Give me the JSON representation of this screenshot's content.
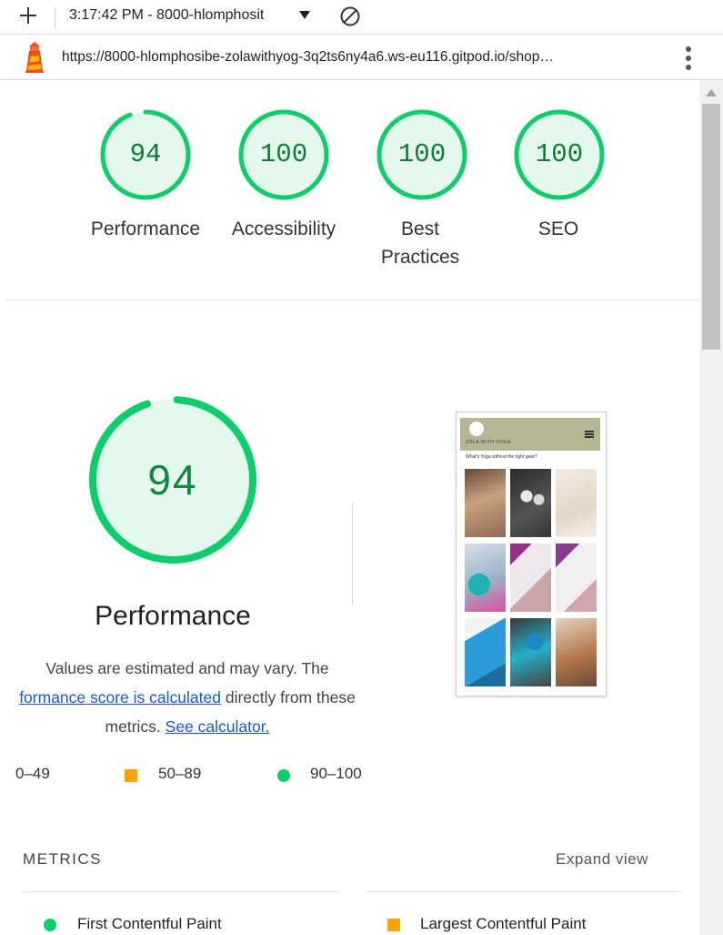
{
  "toolbar": {
    "timestamp": "3:17:42 PM - 8000-hlomphosit",
    "add_icon": "plus-icon",
    "clear_icon": "block-icon"
  },
  "urlbar": {
    "url": "https://8000-hlomphosibe-zolawithyog-3q2ts6ny4a6.ws-eu116.gitpod.io/shop…",
    "icon": "lighthouse-icon"
  },
  "scores": [
    {
      "label": "Performance",
      "value": "94",
      "score": 94
    },
    {
      "label": "Accessibility",
      "value": "100",
      "score": 100
    },
    {
      "label": "Best\nPractices",
      "value": "100",
      "score": 100
    },
    {
      "label": "SEO",
      "value": "100",
      "score": 100
    }
  ],
  "performance": {
    "score": "94",
    "score_value": 94,
    "title": "Performance",
    "desc_1": "Values are estimated and may vary. The",
    "link_1": "formance score is calculated",
    "desc_2": " directly from these",
    "desc_3": "metrics. ",
    "link_2": "See calculator."
  },
  "legend": {
    "fail": "0–49",
    "average": "50–89",
    "pass": "90–100"
  },
  "thumbnail": {
    "brand": "ZOLA WITH YOGA",
    "tagline": "What's Yoga without the right gear?"
  },
  "metrics": {
    "title": "METRICS",
    "expand": "Expand view",
    "items": [
      {
        "name": "First Contentful Paint",
        "status": "pass"
      },
      {
        "name": "Largest Contentful Paint",
        "status": "average"
      }
    ]
  },
  "colors": {
    "pass": "#0cce6b",
    "average": "#ffa400",
    "pass_bg": "#e5f8ee",
    "link": "#1a55d6"
  }
}
